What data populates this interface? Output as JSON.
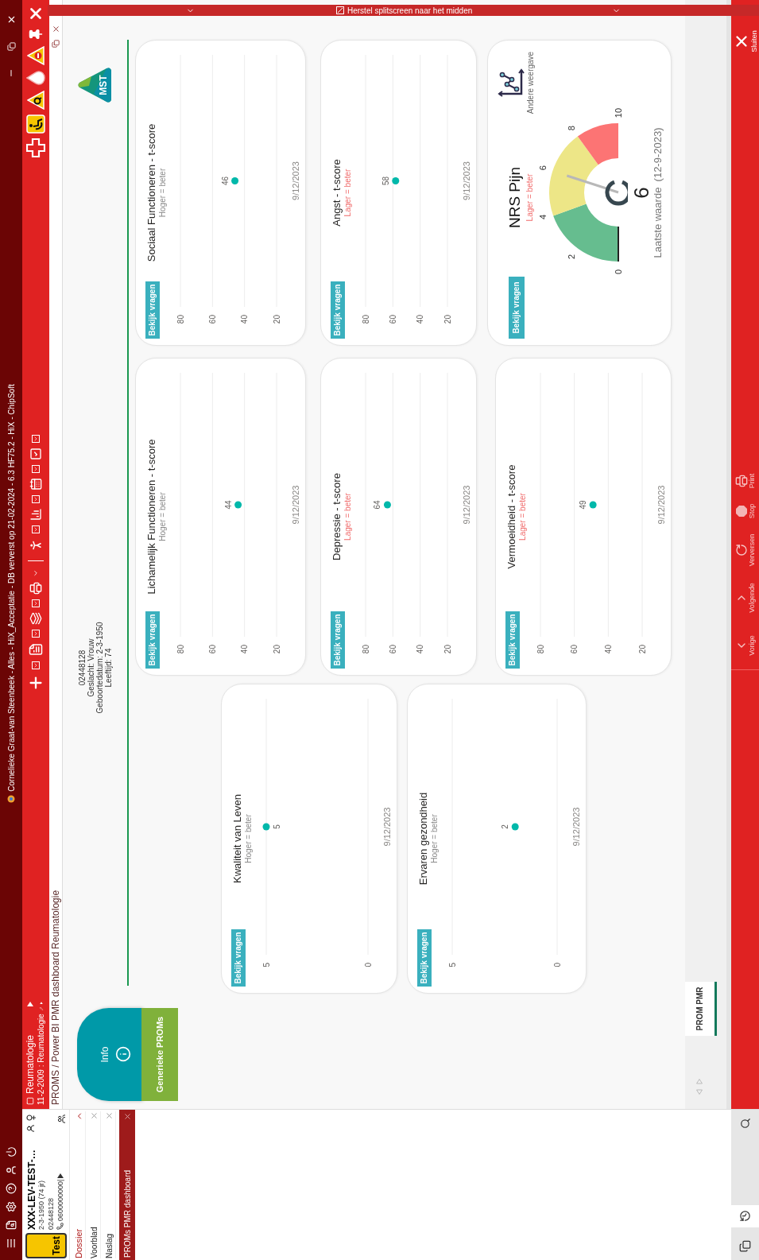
{
  "overlay_bar": {
    "label": "Herstel splitscreen naar het midden"
  },
  "title_bar": {
    "title": "Cornelieke Graat-van Steenbeek - Alles - HiX_Acceptatie - DB ververst op 21-02-2024 - 6.3 HF75.2 - HiX - ChipSoft"
  },
  "patient": {
    "badge": "Test",
    "name": "XXX-LEV-TEST-…",
    "birth": "2-3-1950 (74 jr)",
    "number": "02448128",
    "phone": "0600000000|"
  },
  "nav": [
    {
      "kind": "group",
      "label": "Dossier",
      "expanded": true
    },
    {
      "kind": "item",
      "label": "Voorblad"
    },
    {
      "kind": "item",
      "label": "Naslag"
    }
  ],
  "open_tabs": [
    {
      "label": "PROMs PMR dashboard",
      "selected": true
    }
  ],
  "context": {
    "department": "Reumatologie",
    "episode": "11-2-2009 : Reumatologie"
  },
  "breadcrumb": "PROMS / Power BI PMR dashboard Reumatologie",
  "report": {
    "info_label": "Info",
    "nav_button": "Generieke PROMs",
    "patient_info": [
      "02448128",
      "Geslacht: Vrouw",
      "Geboortedatum: 2-3-1950",
      "Leeftijd: 74"
    ],
    "logo_text": "MST",
    "columns": [
      {
        "cards": [
          {
            "kind": "scatter",
            "button": "Bekijk vragen",
            "title": "Kwaliteit van Leven",
            "subtitle": {
              "text": "Hoger = beter",
              "color": "#8a8a8a"
            },
            "axis_labels": [
              "5",
              "0"
            ],
            "point": {
              "label": "5",
              "color": "#01b8aa"
            },
            "date": "9/12/2023"
          },
          {
            "kind": "scatter",
            "button": "Bekijk vragen",
            "title": "Ervaren gezondheid",
            "subtitle": {
              "text": "Hoger = beter",
              "color": "#8a8a8a"
            },
            "axis_labels": [
              "5",
              "0"
            ],
            "point": {
              "label": "2",
              "color": "#01b8aa"
            },
            "date": "9/12/2023"
          }
        ]
      },
      {
        "cards": [
          {
            "kind": "scatter",
            "button": "Bekijk vragen",
            "title": "Lichamelijk Functioneren - t-score",
            "subtitle": {
              "text": "Hoger = beter",
              "color": "#8a8a8a"
            },
            "axis_labels": [
              "80",
              "60",
              "40",
              "20"
            ],
            "point": {
              "label": "44",
              "color": "#01b8aa"
            },
            "date": "9/12/2023"
          },
          {
            "kind": "scatter",
            "button": "Bekijk vragen",
            "title": "Depressie - t-score",
            "subtitle": {
              "text": "Lager = beter",
              "color": "#f06b6b"
            },
            "axis_labels": [
              "80",
              "60",
              "40",
              "20"
            ],
            "point": {
              "label": "64",
              "color": "#01b8aa"
            },
            "date": "9/12/2023"
          },
          {
            "kind": "scatter",
            "button": "Bekijk vragen",
            "title": "Vermoeidheid - t-score",
            "subtitle": {
              "text": "Lager = beter",
              "color": "#f06b6b"
            },
            "axis_labels": [
              "80",
              "60",
              "40",
              "20"
            ],
            "point": {
              "label": "49",
              "color": "#01b8aa"
            },
            "date": "9/12/2023"
          }
        ]
      },
      {
        "cards": [
          {
            "kind": "scatter",
            "button": "Bekijk vragen",
            "title": "Sociaal Functioneren - t-score",
            "subtitle": {
              "text": "Hoger = beter",
              "color": "#8a8a8a"
            },
            "axis_labels": [
              "80",
              "60",
              "40",
              "20"
            ],
            "point": {
              "label": "46",
              "color": "#01b8aa"
            },
            "date": "9/12/2023"
          },
          {
            "kind": "scatter",
            "button": "Bekijk vragen",
            "title": "Angst - t-score",
            "subtitle": {
              "text": "Lager = beter",
              "color": "#f06b6b"
            },
            "axis_labels": [
              "80",
              "60",
              "40",
              "20"
            ],
            "point": {
              "label": "58",
              "color": "#01b8aa"
            },
            "date": "9/12/2023"
          },
          {
            "kind": "gauge",
            "button": "Bekijk vragen",
            "title": "NRS Pijn",
            "subtitle": {
              "text": "Lager = beter",
              "color": "#f06b6b"
            },
            "toggle_label": "Andere weergave",
            "ticks": [
              "0",
              "2",
              "4",
              "6",
              "8",
              "10"
            ],
            "bands": [
              {
                "color": "#66bd8f"
              },
              {
                "color": "#ede687"
              },
              {
                "color": "#fc7474"
              }
            ],
            "value": "6",
            "caption": "Laatste waarde  (12-9-2023)"
          }
        ]
      }
    ]
  },
  "page_tabs": [
    {
      "label": "PROM PMR",
      "selected": true
    }
  ],
  "action_bar": [
    {
      "kind": "previous",
      "label": "Vorige"
    },
    {
      "kind": "next",
      "label": "Volgende"
    },
    {
      "kind": "refresh",
      "label": "Verversen"
    },
    {
      "kind": "stop",
      "label": "Stop"
    },
    {
      "kind": "print",
      "label": "Print"
    },
    {
      "kind": "close",
      "label": "Sluiten"
    }
  ]
}
